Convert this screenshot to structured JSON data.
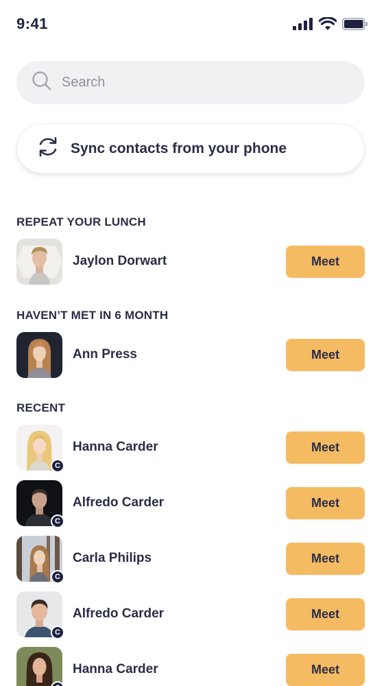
{
  "status_bar": {
    "time": "9:41"
  },
  "search": {
    "placeholder": "Search"
  },
  "sync": {
    "label": "Sync contacts from your phone"
  },
  "sections": {
    "repeat_lunch": "REPEAT YOUR LUNCH",
    "not_met": "HAVEN’T MET IN 6 MONTH",
    "recent": "RECENT"
  },
  "meet_label": "Meet",
  "badge_letter": "C",
  "contacts": [
    {
      "name": "Jaylon Dorwart",
      "section": "repeat_lunch",
      "badge": false
    },
    {
      "name": "Ann Press",
      "section": "not_met",
      "badge": false
    },
    {
      "name": "Hanna Carder",
      "section": "recent",
      "badge": true
    },
    {
      "name": "Alfredo Carder",
      "section": "recent",
      "badge": true
    },
    {
      "name": "Carla Philips",
      "section": "recent",
      "badge": true
    },
    {
      "name": "Alfredo Carder",
      "section": "recent",
      "badge": true
    },
    {
      "name": "Hanna Carder",
      "section": "recent",
      "badge": true
    }
  ],
  "colors": {
    "accent": "#f5bb62",
    "text": "#2a2d46",
    "search_bg": "#f1f1f4",
    "badge": "#1e2140"
  },
  "icons": [
    "signal-icon",
    "wifi-icon",
    "battery-icon",
    "search-icon",
    "sync-icon"
  ]
}
